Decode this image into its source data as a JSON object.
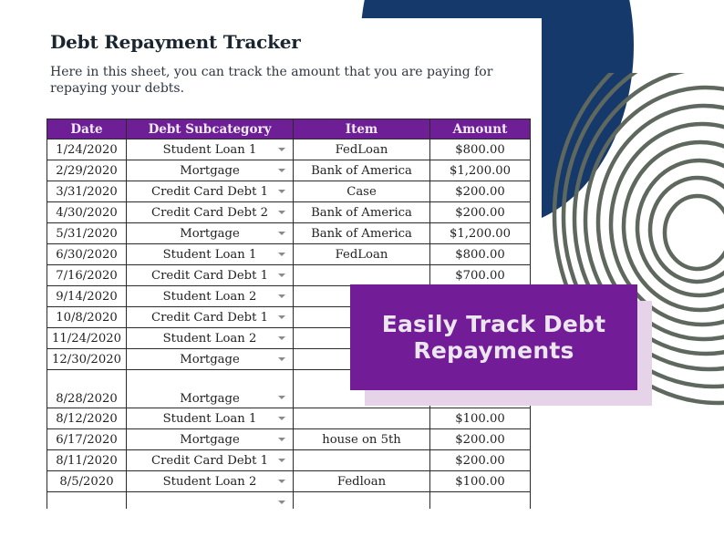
{
  "sheet": {
    "title": "Debt Repayment Tracker",
    "description": "Here in this sheet, you can track the amount that you are paying for repaying your debts.",
    "columns": [
      "Date",
      "Debt Subcategory",
      "Item",
      "Amount"
    ],
    "rows": [
      {
        "date": "1/24/2020",
        "subcategory": "Student Loan 1",
        "item": "FedLoan",
        "amount": "$800.00"
      },
      {
        "date": "2/29/2020",
        "subcategory": "Mortgage",
        "item": "Bank of America",
        "amount": "$1,200.00"
      },
      {
        "date": "3/31/2020",
        "subcategory": "Credit Card Debt 1",
        "item": "Case",
        "amount": "$200.00"
      },
      {
        "date": "4/30/2020",
        "subcategory": "Credit Card Debt 2",
        "item": "Bank of America",
        "amount": "$200.00"
      },
      {
        "date": "5/31/2020",
        "subcategory": "Mortgage",
        "item": "Bank of America",
        "amount": "$1,200.00"
      },
      {
        "date": "6/30/2020",
        "subcategory": "Student Loan 1",
        "item": "FedLoan",
        "amount": "$800.00"
      },
      {
        "date": "7/16/2020",
        "subcategory": "Credit Card Debt 1",
        "item": "",
        "amount": "$700.00"
      },
      {
        "date": "9/14/2020",
        "subcategory": "Student Loan 2",
        "item": "",
        "amount": ""
      },
      {
        "date": "10/8/2020",
        "subcategory": "Credit Card Debt 1",
        "item": "",
        "amount": ""
      },
      {
        "date": "11/24/2020",
        "subcategory": "Student Loan 2",
        "item": "",
        "amount": ""
      },
      {
        "date": "12/30/2020",
        "subcategory": "Mortgage",
        "item": "",
        "amount": ""
      },
      {
        "date": "8/28/2020",
        "subcategory": "Mortgage",
        "item": "",
        "amount": ""
      },
      {
        "date": "8/12/2020",
        "subcategory": "Student Loan 1",
        "item": "",
        "amount": "$100.00"
      },
      {
        "date": "6/17/2020",
        "subcategory": "Mortgage",
        "item": "house on 5th",
        "amount": "$200.00"
      },
      {
        "date": "8/11/2020",
        "subcategory": "Credit Card Debt 1",
        "item": "",
        "amount": "$200.00"
      },
      {
        "date": "8/5/2020",
        "subcategory": "Student Loan 2",
        "item": "Fedloan",
        "amount": "$100.00"
      },
      {
        "date": "",
        "subcategory": "",
        "item": "",
        "amount": ""
      }
    ]
  },
  "banner": {
    "line1": "Easily Track Debt",
    "line2": "Repayments"
  },
  "colors": {
    "header_purple": "#6f1f96",
    "banner_purple": "#721d97",
    "banner_shadow": "#e6d3e9",
    "navy": "#15396b",
    "ring_gray": "#5f685e"
  }
}
